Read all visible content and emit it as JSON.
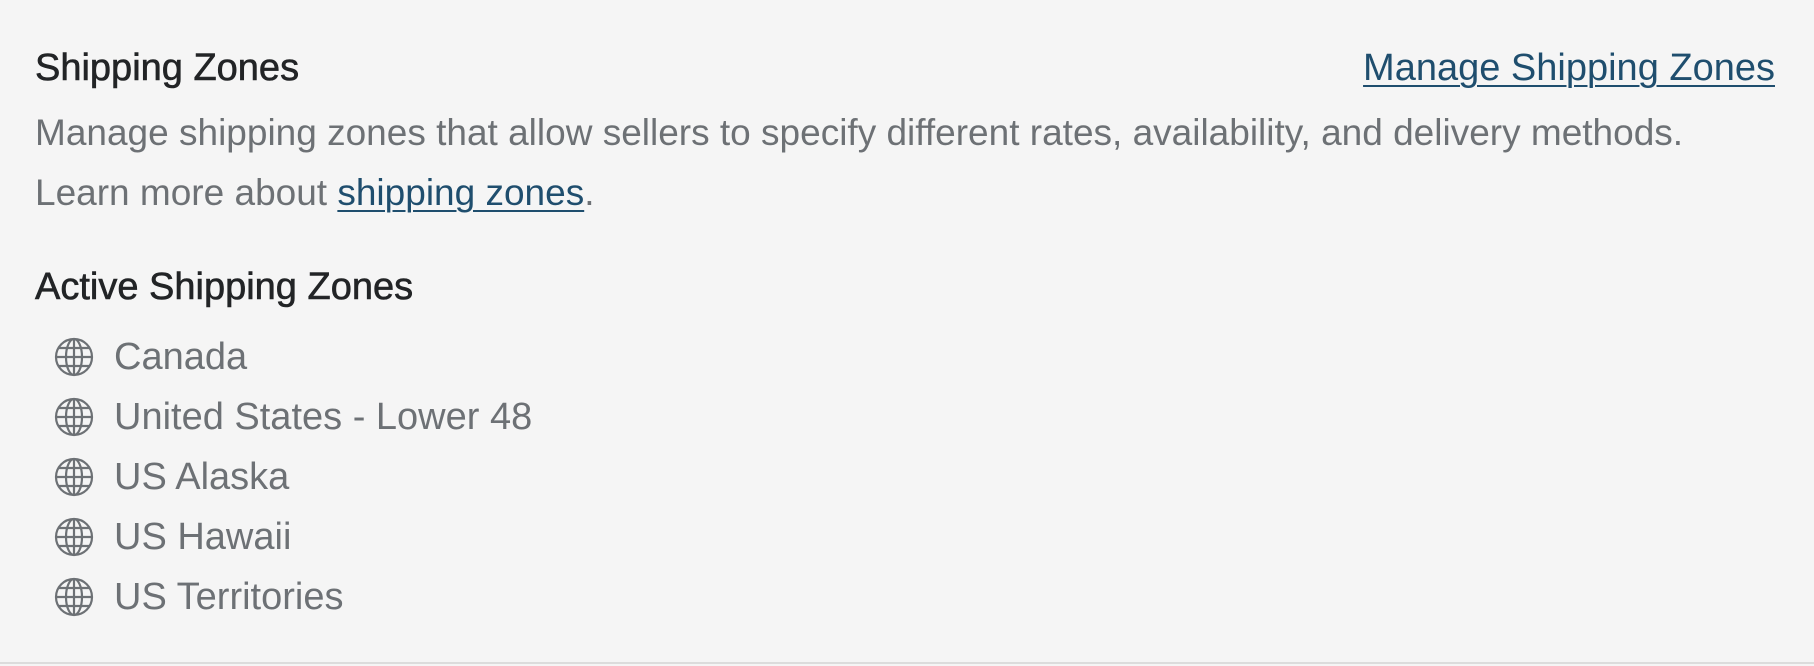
{
  "header": {
    "title": "Shipping Zones",
    "manage_link": "Manage Shipping Zones"
  },
  "description": {
    "line1": "Manage shipping zones that allow sellers to specify different rates, availability, and delivery methods.",
    "line2_prefix": "Learn more about ",
    "line2_link": "shipping zones",
    "line2_suffix": "."
  },
  "active_zones": {
    "title": "Active Shipping Zones",
    "icon": "globe-icon",
    "items": [
      {
        "label": "Canada"
      },
      {
        "label": "United States - Lower 48"
      },
      {
        "label": "US Alaska"
      },
      {
        "label": "US Hawaii"
      },
      {
        "label": "US Territories"
      }
    ]
  },
  "colors": {
    "background": "#f5f5f5",
    "heading": "#222426",
    "body_text": "#6d7175",
    "link": "#1f4e6e",
    "icon": "#6d7175"
  }
}
